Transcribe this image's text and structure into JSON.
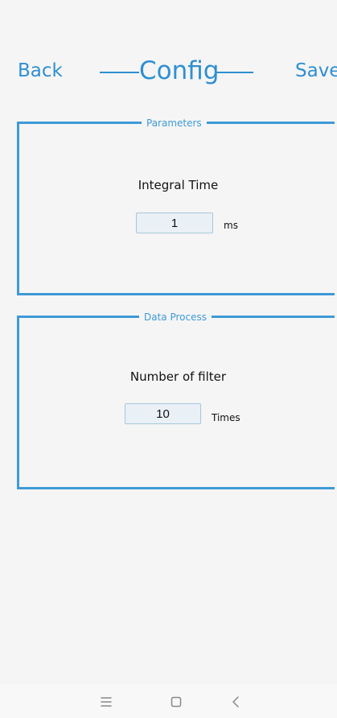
{
  "header": {
    "back_label": "Back",
    "title": "Config",
    "save_label": "Save"
  },
  "parameters": {
    "legend": "Parameters",
    "integral_time_label": "Integral Time",
    "integral_time_value": "1",
    "integral_time_unit": "ms"
  },
  "data_process": {
    "legend": "Data Process",
    "filter_label": "Number of filter",
    "filter_value": "10",
    "filter_unit": "Times"
  },
  "system_navigation": {
    "menu_icon": "menu-icon",
    "home_icon": "home-icon",
    "back_icon": "back-icon"
  },
  "colors": {
    "accent": "#2f8fd0",
    "frame": "#3e9ad7",
    "input_fill": "#e9f0f6",
    "input_border": "#a8c7dc",
    "background": "#f5f5f5"
  }
}
